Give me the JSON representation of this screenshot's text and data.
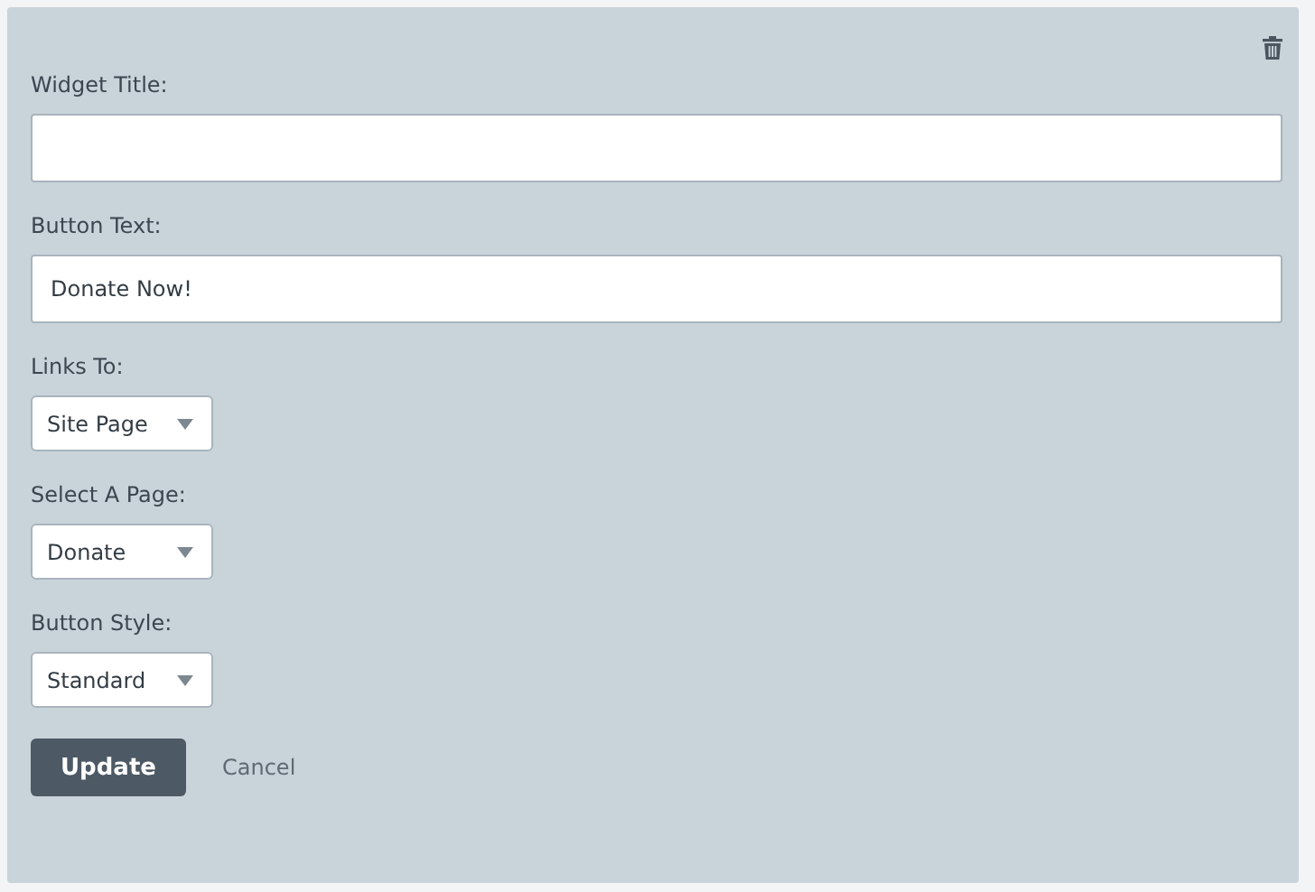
{
  "fields": [
    {
      "kind": "text",
      "label": "Widget Title:"
    },
    {
      "kind": "text",
      "label": "Button Text:",
      "value": "Donate Now!"
    },
    {
      "kind": "select",
      "label": "Links To:",
      "value": "Site Page"
    },
    {
      "kind": "select",
      "label": "Select A Page:",
      "value": "Donate"
    },
    {
      "kind": "select",
      "label": "Button Style:",
      "value": "Standard"
    }
  ],
  "buttons": {
    "primary": "Update",
    "secondary": "Cancel"
  }
}
